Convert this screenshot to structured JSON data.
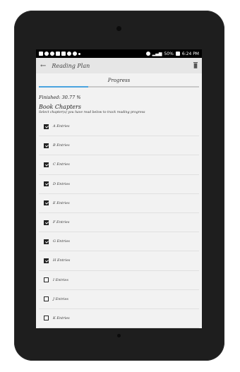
{
  "status": {
    "battery": "50%",
    "time": "6:24 PM"
  },
  "appbar": {
    "title": "Reading Plan"
  },
  "tabs": [
    {
      "label": "Progress",
      "progress": 0.3077
    }
  ],
  "progress": {
    "finished_text": "Finished: 30.77 %"
  },
  "book": {
    "title": "Book Chapters",
    "subtitle": "Select chapter(s) you have read below to track reading progress"
  },
  "chapters": [
    {
      "label": "A Entries",
      "checked": true
    },
    {
      "label": "B Entries",
      "checked": true
    },
    {
      "label": "C Entries",
      "checked": true
    },
    {
      "label": "D Entries",
      "checked": true
    },
    {
      "label": "E Entries",
      "checked": true
    },
    {
      "label": "F Entries",
      "checked": true
    },
    {
      "label": "G Entries",
      "checked": true
    },
    {
      "label": "H Entries",
      "checked": true
    },
    {
      "label": "I Entries",
      "checked": false
    },
    {
      "label": "J Entries",
      "checked": false
    },
    {
      "label": "K Entries",
      "checked": false
    }
  ],
  "icons": {
    "back": "arrow-left-icon",
    "delete": "trash-icon"
  },
  "colors": {
    "accent": "#4aa3df",
    "appbar": "#e6e6e6"
  }
}
